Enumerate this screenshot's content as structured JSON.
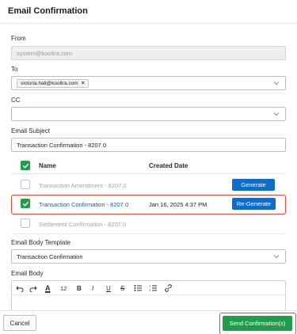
{
  "dialog": {
    "title": "Email Confirmation"
  },
  "from": {
    "label": "From",
    "value": "system@kooltra.com"
  },
  "to": {
    "label": "To",
    "chip": "victoria.hall@kooltra.com",
    "chip_remove": "×"
  },
  "cc": {
    "label": "CC",
    "value": ""
  },
  "subject": {
    "label": "Email Subject",
    "value": "Transaction Confirmation - 8207.0"
  },
  "table": {
    "columns": [
      "Name",
      "Created Date"
    ],
    "header_checked": true,
    "rows": [
      {
        "name": "Transaction Amendment - 8207.0",
        "created": "",
        "action": "Generate",
        "checked": false,
        "style": "muted"
      },
      {
        "name": "Transaction Confirmation - 8207.0",
        "created": "Jan 16, 2025 4:37 PM",
        "action": "Re-Generate",
        "checked": true,
        "style": "link"
      },
      {
        "name": "Settlement Confirmation - 8207.0",
        "created": "",
        "action": "",
        "checked": false,
        "style": "muted"
      }
    ]
  },
  "template": {
    "label": "Email Body Template",
    "value": "Transaction Confirmation"
  },
  "body": {
    "label": "Email Body",
    "toolbar": {
      "font_color": "A",
      "font_size": "12",
      "bold": "B",
      "italic": "I",
      "underline": "U",
      "strikethrough": "S"
    }
  },
  "footer": {
    "cancel": "Cancel",
    "send": "Send Confirmation(s)"
  },
  "colors": {
    "primary_blue": "#0f6cc8",
    "success_green": "#1e9e4a",
    "highlight_red": "#e04b3c",
    "link": "#1d5d9b"
  }
}
